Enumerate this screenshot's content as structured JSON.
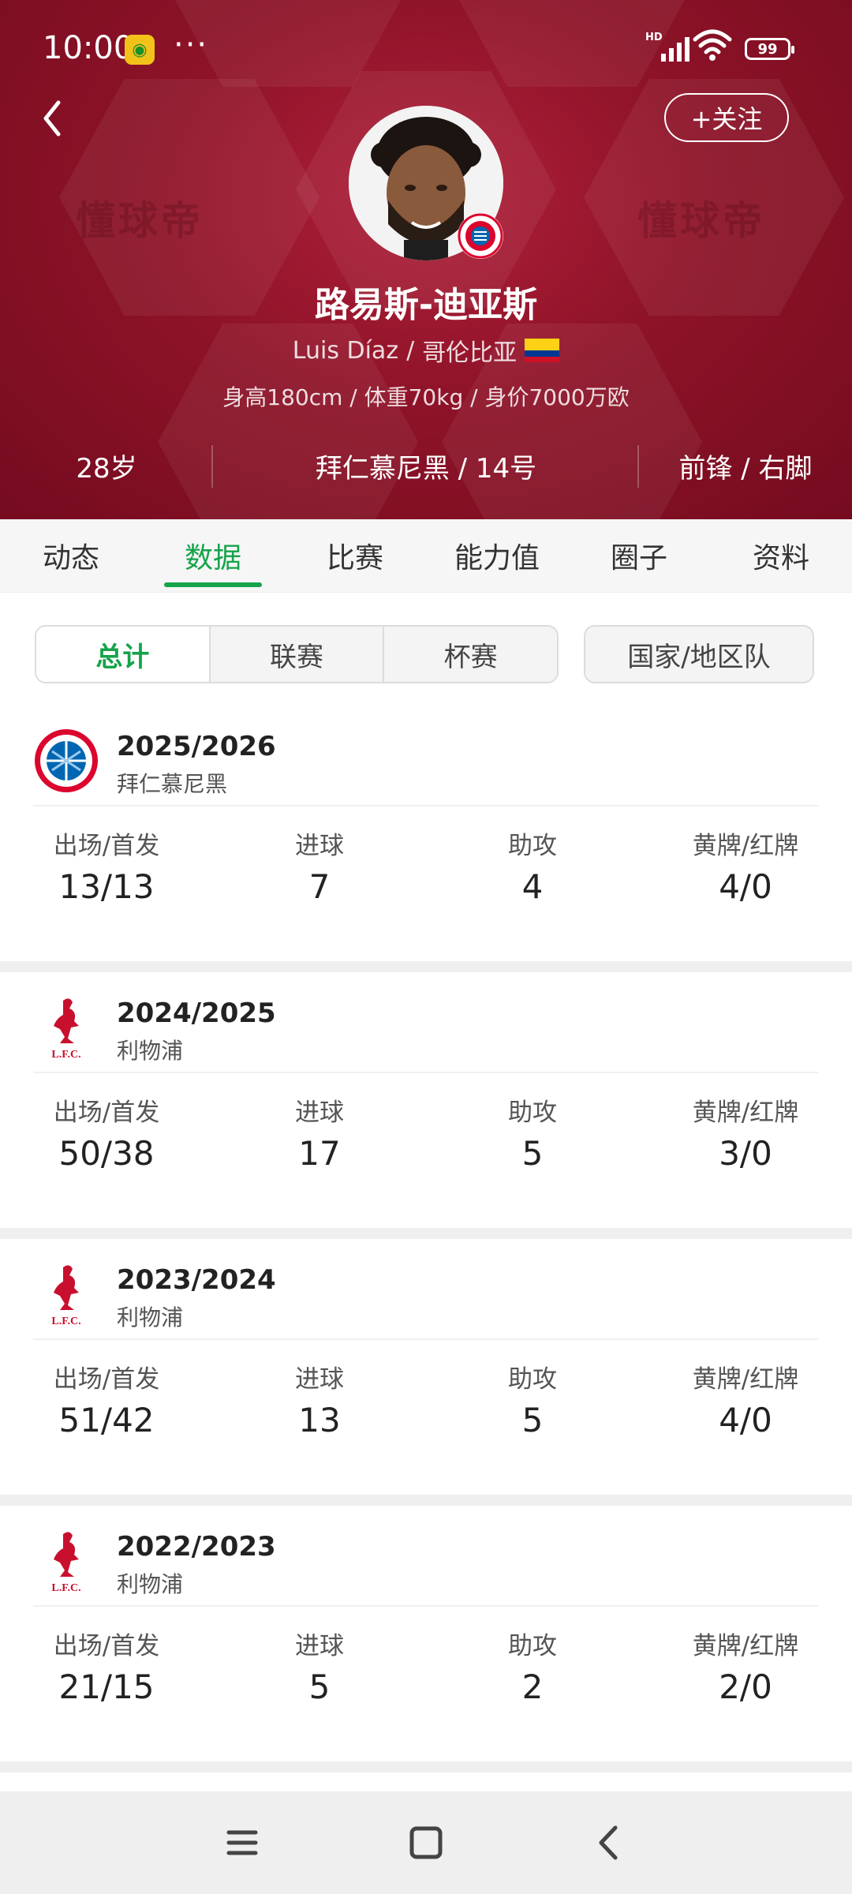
{
  "status_bar": {
    "time": "10:00",
    "dots": "···",
    "network": "HD",
    "battery": "99"
  },
  "header": {
    "follow_label": "+关注",
    "watermark": "懂球帝",
    "player_name": "路易斯-迪亚斯",
    "name_en": "Luis Díaz",
    "country": "哥伦比亚",
    "separator": "/",
    "body_info": "身高180cm / 体重70kg / 身价7000万欧",
    "age": "28岁",
    "team_number": "拜仁慕尼黑 / 14号",
    "position_foot": "前锋 / 右脚",
    "colors": {
      "bg": "#8e1328",
      "accent": "#16a34a"
    }
  },
  "tabs": [
    {
      "label": "动态"
    },
    {
      "label": "数据"
    },
    {
      "label": "比赛"
    },
    {
      "label": "能力值"
    },
    {
      "label": "圈子"
    },
    {
      "label": "资料"
    }
  ],
  "active_tab": "数据",
  "filters": {
    "segments": [
      "总计",
      "联赛",
      "杯赛"
    ],
    "selected": "总计",
    "national": "国家/地区队"
  },
  "stat_labels": {
    "apps": "出场/首发",
    "goals": "进球",
    "assists": "助攻",
    "cards": "黄牌/红牌"
  },
  "seasons": [
    {
      "season": "2025/2026",
      "club": "拜仁慕尼黑",
      "logo": "bayern-logo",
      "apps": "13/13",
      "goals": "7",
      "assists": "4",
      "cards": "4/0"
    },
    {
      "season": "2024/2025",
      "club": "利物浦",
      "logo": "liverpool-logo",
      "apps": "50/38",
      "goals": "17",
      "assists": "5",
      "cards": "3/0"
    },
    {
      "season": "2023/2024",
      "club": "利物浦",
      "logo": "liverpool-logo",
      "apps": "51/42",
      "goals": "13",
      "assists": "5",
      "cards": "4/0"
    },
    {
      "season": "2022/2023",
      "club": "利物浦",
      "logo": "liverpool-logo",
      "apps": "21/15",
      "goals": "5",
      "assists": "2",
      "cards": "2/0"
    }
  ],
  "lfc_text": "L.F.C."
}
